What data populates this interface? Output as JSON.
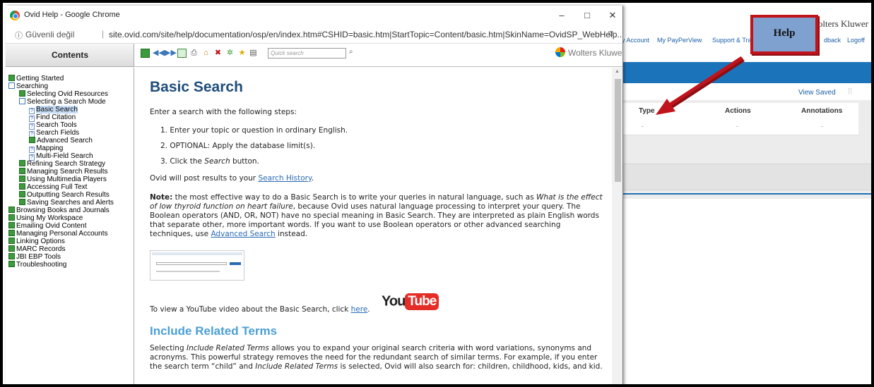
{
  "background_page": {
    "brand": "olters Kluwer",
    "nav": [
      "y Account",
      "My PayPerView",
      "Support & Tra",
      "dback",
      "Logoff"
    ],
    "view_saved": "View Saved",
    "columns": [
      "Type",
      "Actions",
      "Annotations"
    ],
    "cells": [
      "-",
      "-",
      "-"
    ]
  },
  "annotation": {
    "label": "Help"
  },
  "window": {
    "title": "Ovid Help - Google Chrome",
    "minimize": "–",
    "maximize": "□",
    "close": "✕",
    "security": "Güvenli değil",
    "url": "site.ovid.com/site/help/documentation/osp/en/index.htm#CSHID=basic.htm|StartTopic=Content/basic.htm|SkinName=OvidSP_WebHelp..."
  },
  "toolbar": {
    "contents_label": "Contents",
    "search_placeholder": "Quick search",
    "brand": "Wolters Kluwer"
  },
  "tree": [
    {
      "label": "Getting Started",
      "icon": "book"
    },
    {
      "label": "Searching",
      "icon": "open"
    },
    {
      "label": "Selecting Ovid Resources",
      "icon": "book"
    },
    {
      "label": "Selecting a Search Mode",
      "icon": "open"
    },
    {
      "label": "Basic Search",
      "icon": "page"
    },
    {
      "label": "Find Citation",
      "icon": "page"
    },
    {
      "label": "Search Tools",
      "icon": "page"
    },
    {
      "label": "Search Fields",
      "icon": "page"
    },
    {
      "label": "Advanced Search",
      "icon": "book"
    },
    {
      "label": "Mapping",
      "icon": "page"
    },
    {
      "label": "Multi-Field Search",
      "icon": "page"
    },
    {
      "label": "Refining Search Strategy",
      "icon": "book"
    },
    {
      "label": "Managing Search Results",
      "icon": "book"
    },
    {
      "label": "Using Multimedia Players",
      "icon": "book"
    },
    {
      "label": "Accessing Full Text",
      "icon": "book"
    },
    {
      "label": "Outputting Search Results",
      "icon": "book"
    },
    {
      "label": "Saving Searches and Alerts",
      "icon": "book"
    },
    {
      "label": "Browsing Books and Journals",
      "icon": "book"
    },
    {
      "label": "Using My Workspace",
      "icon": "book"
    },
    {
      "label": "Emailing Ovid Content",
      "icon": "book"
    },
    {
      "label": "Managing Personal Accounts",
      "icon": "book"
    },
    {
      "label": "Linking Options",
      "icon": "book"
    },
    {
      "label": "MARC Records",
      "icon": "book"
    },
    {
      "label": "JBI EBP Tools",
      "icon": "book"
    },
    {
      "label": "Troubleshooting",
      "icon": "book"
    }
  ],
  "content": {
    "title": "Basic Search",
    "intro": "Enter a search with the following steps:",
    "step1": "1. Enter your topic or question in ordinary English.",
    "step2": "2. OPTIONAL: Apply the database limit(s).",
    "step3_pre": "3. Click the ",
    "step3_em": "Search",
    "step3_post": " button.",
    "post_pre": "Ovid will post results to your ",
    "post_link": "Search History",
    "post_end": ".",
    "note_label": "Note:",
    "note_a": " the most effective way to do a Basic Search is to write your queries in natural language, such as ",
    "note_em": "What is the effect of low thyroid function on heart failure",
    "note_b": ", because Ovid uses natural language processing to interpret your query. The Boolean operators (AND, OR, NOT) have no special meaning in Basic Search. They are interpreted as plain English words that separate other, more important words. If you want to use Boolean operators or other advanced searching techniques, use ",
    "note_link": "Advanced Search",
    "note_c": " instead.",
    "yt_pre": "To view a YouTube video about the Basic Search, click ",
    "yt_link": "here",
    "yt_end": ".",
    "yt_logo_you": "You",
    "yt_logo_tube": "Tube",
    "h2": "Include Related Terms",
    "p2_a": "Selecting ",
    "p2_em1": "Include Related Terms",
    "p2_b": " allows you to expand your original search criteria with word variations, synonyms and acronyms. This powerful strategy removes the need for the redundant search of similar terms. For example, if you enter the search term “child” and ",
    "p2_em2": "Include Related Terms",
    "p2_c": " is selected, Ovid will also search for: children, childhood, kids, and kid."
  },
  "colors": {
    "accent_blue": "#1b73b9",
    "title_blue": "#1f4e79",
    "annotation_red": "#c0141a",
    "youtube_red": "#e52d27"
  }
}
